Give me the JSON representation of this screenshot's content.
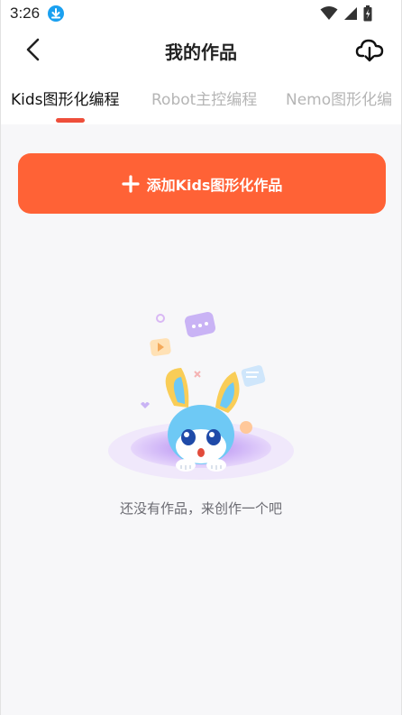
{
  "status_bar": {
    "time": "3:26"
  },
  "header": {
    "title": "我的作品"
  },
  "tabs": [
    {
      "label": "Kids图形化编程",
      "active": true
    },
    {
      "label": "Robot主控编程",
      "active": false
    },
    {
      "label": "Nemo图形化编",
      "active": false
    }
  ],
  "add_button": {
    "label": "添加Kids图形化作品"
  },
  "empty_state": {
    "message": "还没有作品，来创作一个吧"
  },
  "colors": {
    "accent": "#ff6236",
    "indicator": "#ee4e3a"
  },
  "icons": {
    "back": "chevron-left-icon",
    "cloud": "cloud-download-icon",
    "add": "plus-icon"
  }
}
